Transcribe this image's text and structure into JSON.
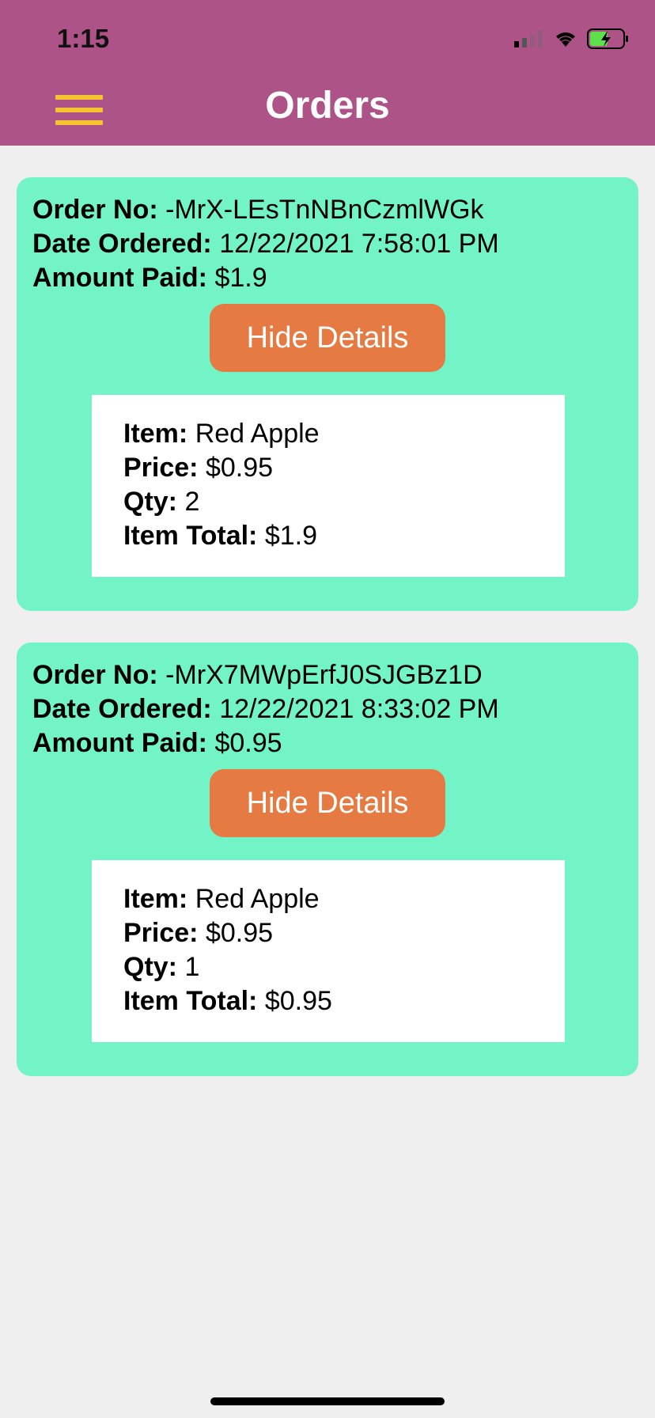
{
  "status_bar": {
    "time": "1:15",
    "icons": [
      "signal-icon",
      "wifi-icon",
      "battery-charging-icon"
    ]
  },
  "header": {
    "title": "Orders",
    "menu_icon": "hamburger-menu-icon",
    "background": "#ad5387",
    "menu_color": "#f4c430"
  },
  "labels": {
    "order_no": "Order No:",
    "date_ordered": "Date Ordered:",
    "amount_paid": "Amount Paid:",
    "item": "Item:",
    "price": "Price:",
    "qty": "Qty:",
    "item_total": "Item Total:"
  },
  "orders": [
    {
      "order_no": "-MrX-LEsTnNBnCzmlWGk",
      "date_ordered": "12/22/2021 7:58:01 PM",
      "amount_paid": "$1.9",
      "button_label": "Hide Details",
      "items": [
        {
          "item": "Red Apple",
          "price": "$0.95",
          "qty": "2",
          "item_total": "$1.9"
        }
      ]
    },
    {
      "order_no": "-MrX7MWpErfJ0SJGBz1D",
      "date_ordered": "12/22/2021 8:33:02 PM",
      "amount_paid": "$0.95",
      "button_label": "Hide Details",
      "items": [
        {
          "item": "Red Apple",
          "price": "$0.95",
          "qty": "1",
          "item_total": "$0.95"
        }
      ]
    }
  ],
  "colors": {
    "card": "#72f4c6",
    "button": "#e57a42",
    "page_background": "#efefef"
  }
}
